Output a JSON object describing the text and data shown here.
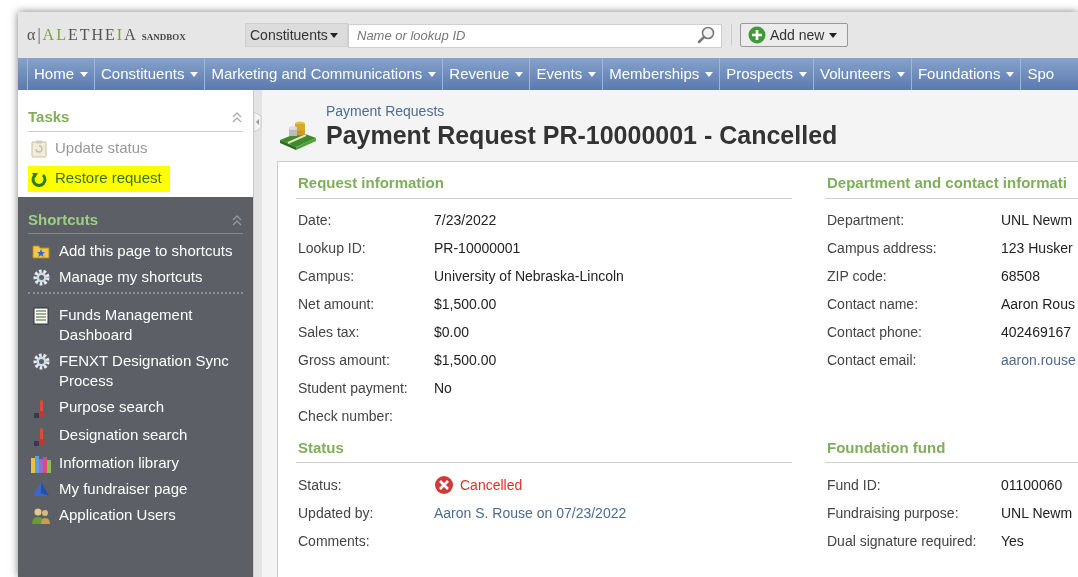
{
  "logo": {
    "parts": [
      {
        "text": "α|",
        "color": "#555555"
      },
      {
        "text": "AL",
        "color": "#7aa33a"
      },
      {
        "text": "ETHE",
        "color": "#555555"
      },
      {
        "text": "I",
        "color": "#7aa33a"
      },
      {
        "text": "A",
        "color": "#555555"
      }
    ],
    "tag": "SANDBOX"
  },
  "search": {
    "scope": "Constituents",
    "placeholder": "Name or lookup ID"
  },
  "add_button": "Add new",
  "nav": [
    "Home",
    "Constituents",
    "Marketing and Communications",
    "Revenue",
    "Events",
    "Memberships",
    "Prospects",
    "Volunteers",
    "Foundations",
    "Spo"
  ],
  "tasks": {
    "title": "Tasks",
    "items": [
      {
        "label": "Update status",
        "kind": "clipboard",
        "disabled": true,
        "highlighted": false
      },
      {
        "label": "Restore request",
        "kind": "restore",
        "disabled": false,
        "highlighted": true
      }
    ]
  },
  "shortcuts": {
    "title": "Shortcuts",
    "items": [
      {
        "label": "Add this page to shortcuts",
        "kind": "folder-star",
        "divider_after": false
      },
      {
        "label": "Manage my shortcuts",
        "kind": "gear",
        "divider_after": true
      },
      {
        "label": "Funds Management Dashboard",
        "kind": "document",
        "divider_after": false
      },
      {
        "label": "FENXT Designation Sync Process",
        "kind": "gear",
        "divider_after": false
      },
      {
        "label": "Purpose search",
        "kind": "thermometer",
        "divider_after": false
      },
      {
        "label": "Designation search",
        "kind": "thermometer",
        "divider_after": false
      },
      {
        "label": "Information library",
        "kind": "books",
        "divider_after": false
      },
      {
        "label": "My fundraiser page",
        "kind": "pyramid",
        "divider_after": false
      },
      {
        "label": "Application Users",
        "kind": "users",
        "divider_after": false
      }
    ]
  },
  "breadcrumb": "Payment Requests",
  "title": "Payment Request PR-10000001 - Cancelled",
  "sections": [
    {
      "title": "Request information",
      "rows": [
        {
          "label": "Date:",
          "value": "7/23/2022",
          "kind": "text"
        },
        {
          "label": "Lookup ID:",
          "value": "PR-10000001",
          "kind": "text"
        },
        {
          "label": "Campus:",
          "value": "University of Nebraska-Lincoln",
          "kind": "text"
        },
        {
          "label": "Net amount:",
          "value": "$1,500.00",
          "kind": "text"
        },
        {
          "label": "Sales tax:",
          "value": "$0.00",
          "kind": "text"
        },
        {
          "label": "Gross amount:",
          "value": "$1,500.00",
          "kind": "text"
        },
        {
          "label": "Student payment:",
          "value": "No",
          "kind": "text"
        },
        {
          "label": "Check number:",
          "kind": "text"
        }
      ]
    },
    {
      "title": "Department and contact informati",
      "rows": [
        {
          "label": "Department:",
          "value": "UNL Newm",
          "kind": "text"
        },
        {
          "label": "Campus address:",
          "value": "123 Husker",
          "kind": "text"
        },
        {
          "label": "ZIP code:",
          "value": "68508",
          "kind": "text"
        },
        {
          "label": "Contact name:",
          "value": "Aaron Rous",
          "kind": "text"
        },
        {
          "label": "Contact phone:",
          "value": "402469167",
          "kind": "text"
        },
        {
          "label": "Contact email:",
          "value": "aaron.rouse",
          "kind": "link"
        }
      ]
    },
    {
      "title": "Status",
      "rows": [
        {
          "label": "Status:",
          "value": "Cancelled",
          "kind": "status"
        },
        {
          "label": "Updated by:",
          "value": "Aaron S. Rouse on 07/23/2022",
          "kind": "link"
        },
        {
          "label": "Comments:",
          "kind": "text"
        }
      ]
    },
    {
      "title": "Foundation fund",
      "rows": [
        {
          "label": "Fund ID:",
          "value": "01100060",
          "kind": "text"
        },
        {
          "label": "Fundraising purpose:",
          "value": "UNL Newm",
          "kind": "text"
        },
        {
          "label": "Dual signature required:",
          "value": "Yes",
          "kind": "text"
        }
      ]
    }
  ]
}
